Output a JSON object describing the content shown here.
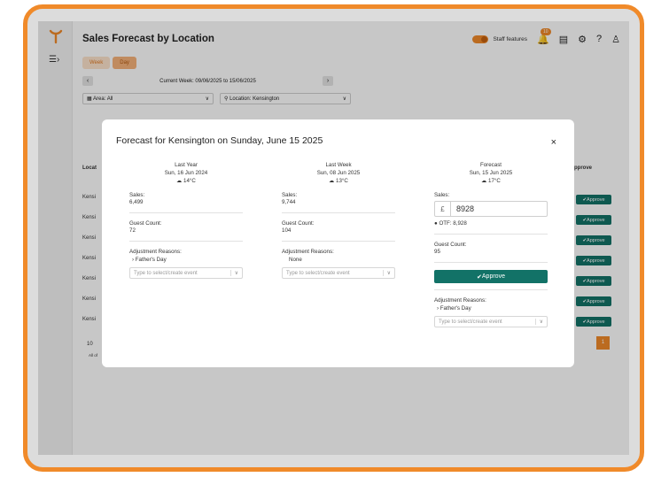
{
  "header": {
    "title": "Sales Forecast by Location",
    "staff_features_label": "Staff features",
    "notification_count": "10"
  },
  "view_tabs": [
    "Week",
    "Day"
  ],
  "week_nav": {
    "label": "Current Week: 09/06/2025 to 15/06/2025"
  },
  "filters": {
    "area_label": "Area:",
    "area_value": "All",
    "location_label": "Location:",
    "location_value": "Kensington"
  },
  "background_table": {
    "location_header": "Locat",
    "approve_header": "pprove",
    "row_label": "Kensi",
    "approve_label": "Approve",
    "page_size": "10",
    "page_info": "All of",
    "current_page": "1"
  },
  "modal": {
    "title": "Forecast for Kensington on Sunday, June 15 2025",
    "close_label": "×",
    "columns": [
      {
        "heading": "Last Year",
        "date": "Sun, 16 Jun 2024",
        "temp": "14°C",
        "sales_label": "Sales:",
        "sales_value": "6,499",
        "guest_label": "Guest Count:",
        "guest_value": "72",
        "reasons_label": "Adjustment Reasons:",
        "reason": "Father's Day",
        "select_placeholder": "Type to select/create event"
      },
      {
        "heading": "Last Week",
        "date": "Sun, 08 Jun 2025",
        "temp": "13°C",
        "sales_label": "Sales:",
        "sales_value": "9,744",
        "guest_label": "Guest Count:",
        "guest_value": "104",
        "reasons_label": "Adjustment Reasons:",
        "reason": "None",
        "select_placeholder": "Type to select/create event"
      },
      {
        "heading": "Forecast",
        "date": "Sun, 15 Jun 2025",
        "temp": "17°C",
        "sales_label": "Sales:",
        "currency": "£",
        "sales_value": "8928",
        "otf_label": "OTF:",
        "otf_value": "8,928",
        "guest_label": "Guest Count:",
        "guest_value": "95",
        "approve_label": "Approve",
        "reasons_label": "Adjustment Reasons:",
        "reason": "Father's Day",
        "select_placeholder": "Type to select/create event"
      }
    ]
  },
  "colors": {
    "accent": "#f08a2a",
    "approve": "#127267"
  }
}
